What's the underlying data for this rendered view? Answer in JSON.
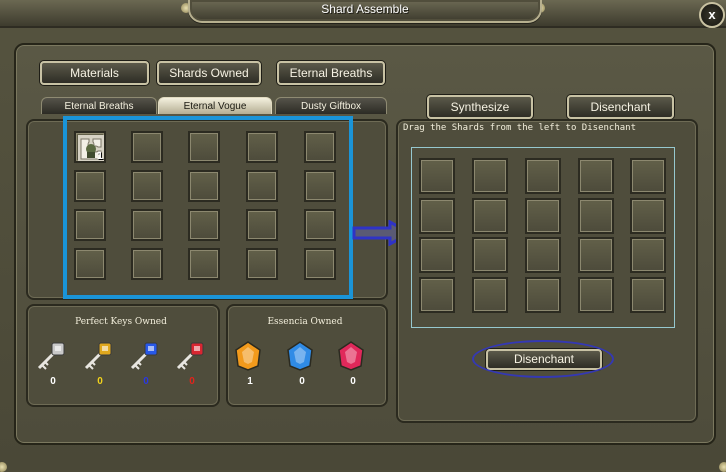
{
  "window": {
    "title": "Shard Assemble",
    "close_label": "x"
  },
  "top_tabs": [
    {
      "label": "Materials"
    },
    {
      "label": "Shards Owned"
    },
    {
      "label": "Eternal Breaths"
    }
  ],
  "sub_tabs": [
    {
      "label": "Eternal Breaths",
      "active": false
    },
    {
      "label": "Eternal Vogue",
      "active": true
    },
    {
      "label": "Dusty Giftbox",
      "active": false
    }
  ],
  "right_tabs": {
    "synthesize_label": "Synthesize",
    "disenchant_label": "Disenchant"
  },
  "shard_inventory": {
    "item": {
      "name": "shard-item",
      "count": "1"
    }
  },
  "disenchant_panel": {
    "hint": "Drag the Shards from the left to Disenchant",
    "action_label": "Disenchant"
  },
  "perfect_keys": {
    "title": "Perfect Keys Owned",
    "items": [
      {
        "icon": "silver-key-icon",
        "count": "0",
        "color": "#ffffff",
        "accent": "#c9c9c9"
      },
      {
        "icon": "gold-key-icon",
        "count": "0",
        "color": "#f1d21c",
        "accent": "#e0a81e"
      },
      {
        "icon": "blue-key-icon",
        "count": "0",
        "color": "#2a38e0",
        "accent": "#2758e8"
      },
      {
        "icon": "red-key-icon",
        "count": "0",
        "color": "#e2231c",
        "accent": "#d92631"
      }
    ]
  },
  "essencia": {
    "title": "Essencia Owned",
    "items": [
      {
        "icon": "orange-essencia-icon",
        "count": "1",
        "color": "#ffffff",
        "accent": "#f29a1c"
      },
      {
        "icon": "blue-essencia-icon",
        "count": "0",
        "color": "#ffffff",
        "accent": "#2f8be6"
      },
      {
        "icon": "red-essencia-icon",
        "count": "0",
        "color": "#ffffff",
        "accent": "#e0285a"
      }
    ]
  },
  "colors": {
    "highlight_blue": "#1a94d8",
    "annotation_navy": "#3438b4",
    "panel_olive": "#4f4d3c"
  }
}
